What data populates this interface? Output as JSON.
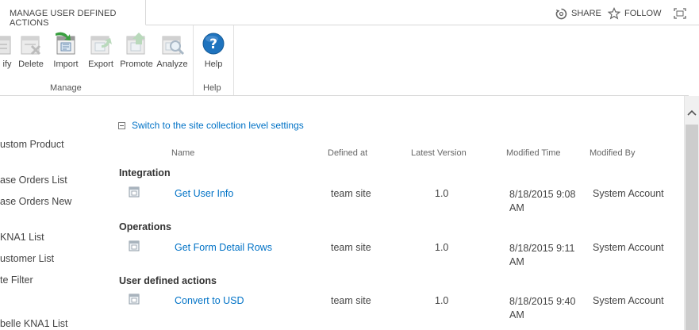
{
  "tab": {
    "title": "MANAGE USER DEFINED ACTIONS"
  },
  "top_actions": {
    "share": "SHARE",
    "follow": "FOLLOW"
  },
  "ribbon": {
    "buttons": [
      {
        "label": "ify",
        "icon": "modify-icon"
      },
      {
        "label": "Delete",
        "icon": "delete-icon"
      },
      {
        "label": "Import",
        "icon": "import-icon"
      },
      {
        "label": "Export",
        "icon": "export-icon"
      },
      {
        "label": "Promote",
        "icon": "promote-icon"
      },
      {
        "label": "Analyze",
        "icon": "analyze-icon"
      },
      {
        "label": "Help",
        "icon": "help-icon"
      }
    ],
    "groups": {
      "manage": "Manage",
      "help": "Help"
    }
  },
  "leftnav": {
    "items": [
      "ustom Product",
      "ase Orders List",
      "ase Orders New",
      "KNA1 List",
      "ustomer List",
      "te Filter",
      "belle KNA1 List"
    ]
  },
  "main": {
    "switch_link": "Switch to the site collection level settings",
    "columns": {
      "name": "Name",
      "defined_at": "Defined at",
      "latest_version": "Latest Version",
      "modified_time": "Modified Time",
      "modified_by": "Modified By"
    },
    "sections": [
      {
        "title": "Integration",
        "row": {
          "name": "Get User Info",
          "defined_at": "team site",
          "version": "1.0",
          "time_line1": "8/18/2015 9:08",
          "time_line2": "AM",
          "by": "System Account"
        }
      },
      {
        "title": "Operations",
        "row": {
          "name": "Get Form Detail Rows",
          "defined_at": "team site",
          "version": "1.0",
          "time_line1": "8/18/2015 9:11",
          "time_line2": "AM",
          "by": "System Account"
        }
      },
      {
        "title": "User defined actions",
        "row": {
          "name": "Convert to USD",
          "defined_at": "team site",
          "version": "1.0",
          "time_line1": "8/18/2015 9:40",
          "time_line2": "AM",
          "by": "System Account"
        }
      }
    ]
  },
  "colors": {
    "link": "#0072c6",
    "help_blue": "#1e73be",
    "accent_green": "#3aa040"
  }
}
